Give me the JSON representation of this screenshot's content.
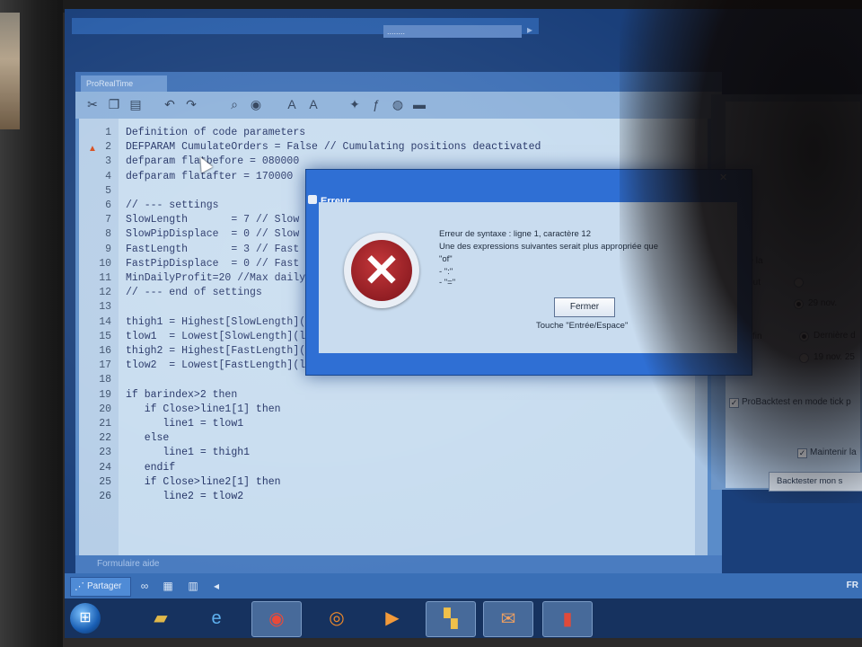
{
  "browser": {
    "url_fragment": "........"
  },
  "app": {
    "tab_label": "ProRealTime",
    "toolbar_icons": [
      "document-icon",
      "copy-icon",
      "paste-icon",
      "undo-icon",
      "redo-icon",
      "search-icon",
      "zoom-icon",
      "font-a-icon",
      "font-a-large-icon",
      "lightbulb-icon",
      "function-icon",
      "globe-icon",
      "keyboard-icon"
    ],
    "code_lines": [
      {
        "n": "1",
        "text": "Definition of code parameters"
      },
      {
        "n": "2",
        "text": "DEFPARAM CumulateOrders = False // Cumulating positions deactivated"
      },
      {
        "n": "3",
        "text": "defparam flatbefore = 080000"
      },
      {
        "n": "4",
        "text": "defparam flatafter = 170000"
      },
      {
        "n": "5",
        "text": ""
      },
      {
        "n": "6",
        "text": "// --- settings"
      },
      {
        "n": "7",
        "text": "SlowLength       = 7 // Slow"
      },
      {
        "n": "8",
        "text": "SlowPipDisplace  = 0 // Slow"
      },
      {
        "n": "9",
        "text": "FastLength       = 3 // Fast"
      },
      {
        "n": "10",
        "text": "FastPipDisplace  = 0 // Fast"
      },
      {
        "n": "11",
        "text": "MinDailyProfit=20 //Max daily"
      },
      {
        "n": "12",
        "text": "// --- end of settings"
      },
      {
        "n": "13",
        "text": ""
      },
      {
        "n": "14",
        "text": "thigh1 = Highest[SlowLength](l"
      },
      {
        "n": "15",
        "text": "tlow1  = Lowest[SlowLength](l"
      },
      {
        "n": "16",
        "text": "thigh2 = Highest[FastLength](l"
      },
      {
        "n": "17",
        "text": "tlow2  = Lowest[FastLength](l"
      },
      {
        "n": "18",
        "text": ""
      },
      {
        "n": "19",
        "text": "if barindex>2 then"
      },
      {
        "n": "20",
        "text": "   if Close>line1[1] then"
      },
      {
        "n": "21",
        "text": "      line1 = tlow1"
      },
      {
        "n": "22",
        "text": "   else"
      },
      {
        "n": "23",
        "text": "      line1 = thigh1"
      },
      {
        "n": "24",
        "text": "   endif"
      },
      {
        "n": "25",
        "text": "   if Close>line2[1] then"
      },
      {
        "n": "26",
        "text": "      line2 = tlow2"
      }
    ],
    "status_text": "Formulaire aide",
    "share_label": "Partager",
    "tray_text": "FR"
  },
  "right_panel": {
    "line1": "d",
    "line2": "de de la",
    "radio1_label": "début",
    "radio2_label": "29 nov.",
    "radio3_label": "Dernière d",
    "radio4_label": "19 nov. 25",
    "fin_label": "fin",
    "checkbox1_label": "ProBacktest en mode tick p",
    "checkbox2_label": "Maintenir la",
    "button_label": "Backtester mon s"
  },
  "dialog": {
    "title": "Erreur",
    "line1": "Erreur de syntaxe : ligne 1, caractère 12",
    "line2": "Une des expressions suivantes serait plus appropriée que",
    "line3": "\"of\"",
    "line4": "- \":\"",
    "line5": "- \"=\"",
    "button_label": "Fermer",
    "hint": "Touche \"Entrée/Espace\""
  },
  "taskbar": {
    "items": [
      "explorer-icon",
      "ie-icon",
      "chrome-icon",
      "firefox-icon",
      "media-player-icon",
      "windows-icon",
      "outlook-icon",
      "trading-chart-icon"
    ]
  },
  "colors": {
    "editor_bg": "#c7dcef",
    "code_text": "#1f2f63",
    "dialog_frame": "#2f6fd4",
    "error_red": "#a8262b"
  }
}
